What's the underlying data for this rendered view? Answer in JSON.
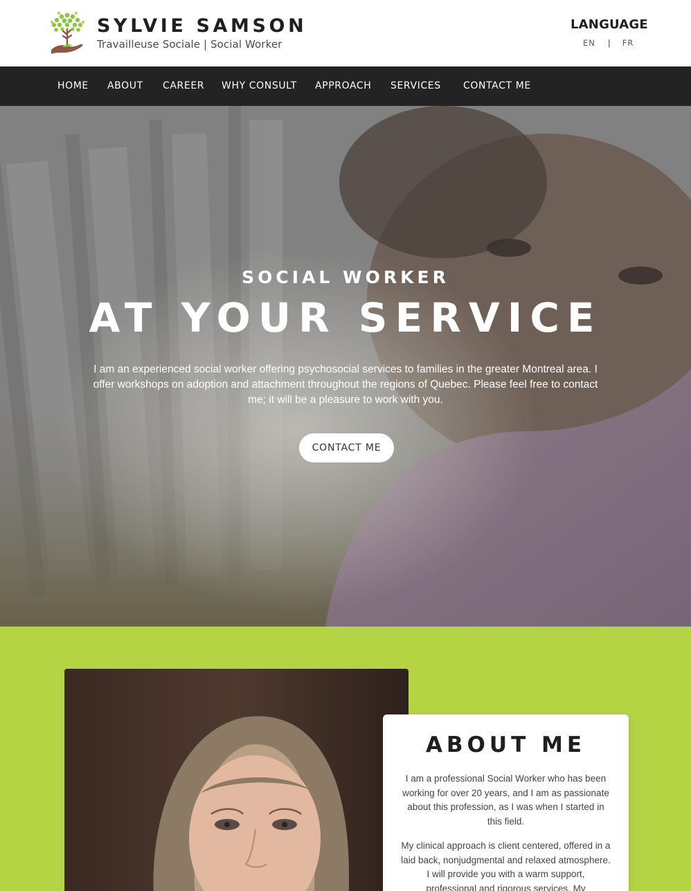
{
  "header": {
    "brand_name": "SYLVIE SAMSON",
    "brand_tagline": "Travailleuse Sociale | Social Worker",
    "language_title": "LANGUAGE",
    "language_options": [
      "EN",
      "FR"
    ],
    "language_separator": "|"
  },
  "nav": {
    "items": [
      "HOME",
      "ABOUT",
      "CAREER",
      "WHY CONSULT",
      "APPROACH",
      "SERVICES",
      "CONTACT ME"
    ]
  },
  "hero": {
    "kicker": "SOCIAL WORKER",
    "title": "AT YOUR SERVICE",
    "text": "I am an experienced social worker offering psychosocial services to families in the greater Montreal area. I offer workshops on adoption and attachment throughout the regions of Quebec. Please feel free to contact me; it will be a pleasure to work with you.",
    "button_label": "CONTACT ME"
  },
  "about": {
    "title": "ABOUT ME",
    "paragraph_1": "I am a professional Social Worker who has been working for over 20 years, and I am as passionate about this profession, as I was when I started in this field.",
    "paragraph_2": "My clinical approach is client centered, offered in a laid back, nonjudgmental and relaxed atmosphere. I will provide you with a warm support, professional and rigorous services. My"
  },
  "colors": {
    "nav_background": "#232323",
    "about_background": "#b5d443",
    "logo_leaf_green": "#8cc63f",
    "logo_hand_brown": "#8a5a44"
  },
  "icons": {
    "logo": "tree-in-hands-logo"
  }
}
